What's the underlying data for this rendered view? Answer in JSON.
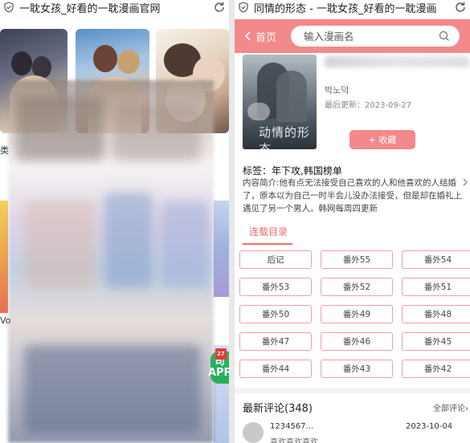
{
  "left_screen": {
    "title": "一耽女孩_好看的一耽漫画官网",
    "text_fragments": [
      "类",
      "Vo"
    ],
    "app_badge": {
      "label_top": "司",
      "label_bottom": "APP",
      "tag": "27"
    }
  },
  "right_screen": {
    "title": "同情的形态 - 一耽女孩_好看的一耽漫画",
    "header": {
      "back_label": "首页",
      "search_placeholder": "输入漫画名"
    },
    "book": {
      "cover_text": "动情的形态",
      "author": "박노덕",
      "updated": "最后更新：2023-09-27",
      "favorite_label": "+ 收藏",
      "tags": "标签：年下攻,韩国榜单",
      "description": "内容简介:他有点无法接受自己喜欢的人和他喜欢的人结婚了，原本以为自己一时半会儿没办法接受，但是却在婚礼上遇见了另一个男人。韩网每周四更新"
    },
    "tab_label": "连载目录",
    "chapters": [
      "后记",
      "番外55",
      "番外54",
      "番外53",
      "番外52",
      "番外51",
      "番外50",
      "番外49",
      "番外48",
      "番外47",
      "番外46",
      "番外45",
      "番外44",
      "番外43",
      "番外42"
    ],
    "comments": {
      "title": "最新评论(348)",
      "all_label": "全部评论›",
      "items": [
        {
          "user": "1234567...",
          "date": "2023-10-04",
          "text": "喜欢喜欢喜欢"
        }
      ]
    }
  },
  "colors": {
    "accent": "#f3898a",
    "tab_text": "#f06a6c",
    "chapter_border": "#f0a0a1"
  }
}
